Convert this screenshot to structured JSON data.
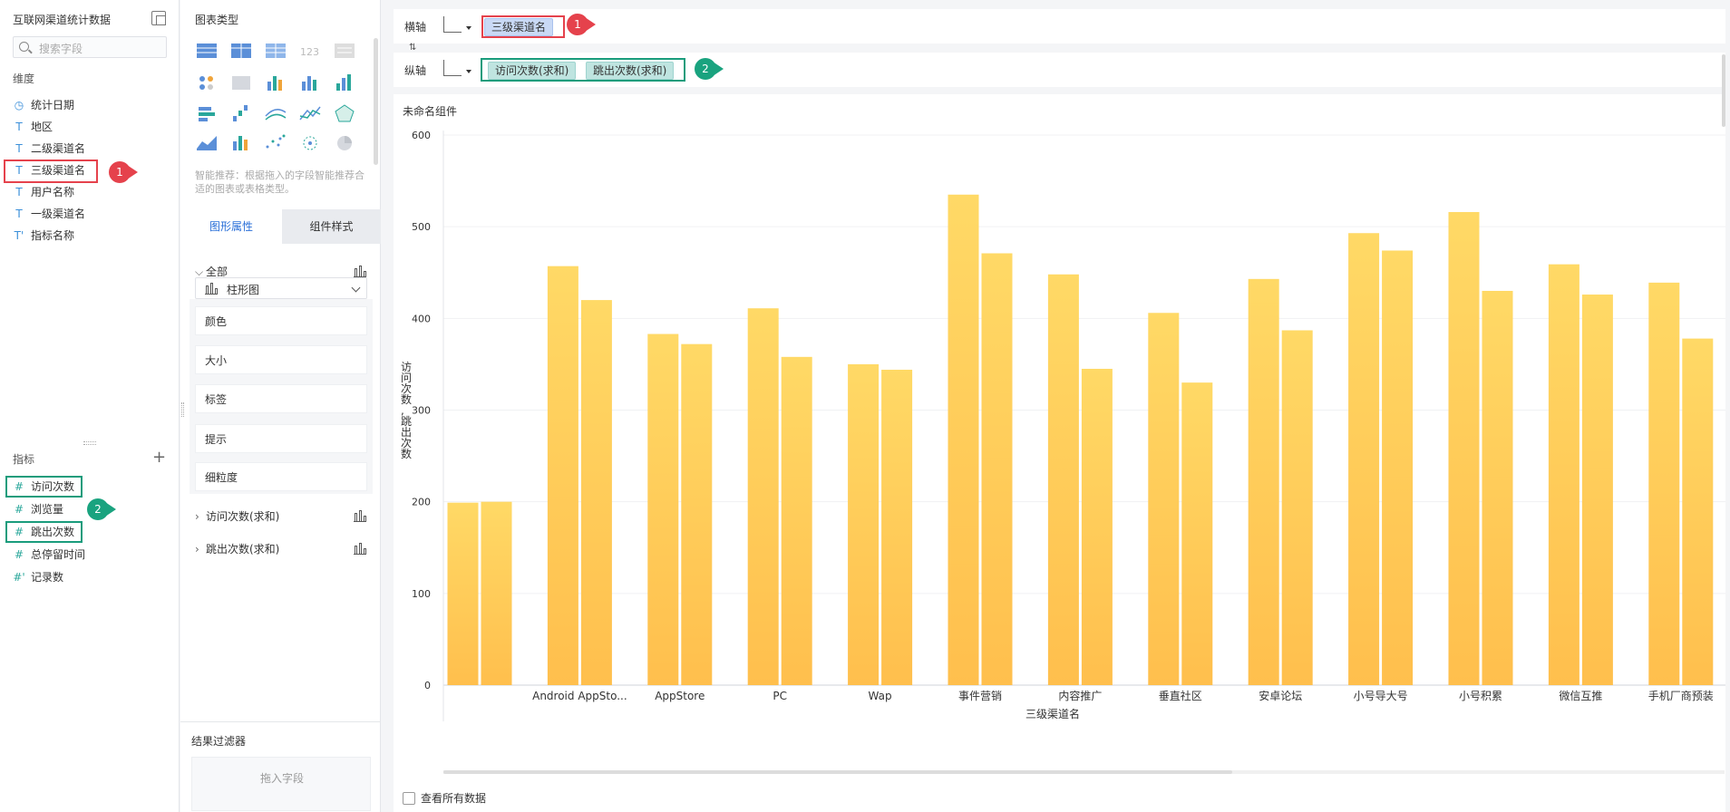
{
  "left_panel": {
    "dataset_title": "互联网渠道统计数据",
    "search_placeholder": "搜索字段",
    "dimensions_label": "维度",
    "dimensions": [
      {
        "type": "date",
        "icon": "clock-icon",
        "name": "统计日期"
      },
      {
        "type": "text",
        "icon": "T",
        "name": "地区"
      },
      {
        "type": "text",
        "icon": "T",
        "name": "二级渠道名"
      },
      {
        "type": "text",
        "icon": "T",
        "name": "三级渠道名",
        "highlight": "red"
      },
      {
        "type": "text",
        "icon": "T",
        "name": "用户名称"
      },
      {
        "type": "text",
        "icon": "T",
        "name": "一级渠道名"
      },
      {
        "type": "text-calc",
        "icon": "T'",
        "name": "指标名称"
      }
    ],
    "measures_label": "指标",
    "measures": [
      {
        "icon": "#",
        "name": "访问次数",
        "highlight": "green"
      },
      {
        "icon": "#",
        "name": "浏览量"
      },
      {
        "icon": "#",
        "name": "跳出次数",
        "highlight": "green"
      },
      {
        "icon": "#",
        "name": "总停留时间"
      },
      {
        "icon": "#'",
        "name": "记录数"
      }
    ]
  },
  "middle_panel": {
    "chart_types_label": "图表类型",
    "hint": "智能推荐：根据拖入的字段智能推荐合适的图表或表格类型。",
    "tabs": [
      "图形属性",
      "组件样式"
    ],
    "all_group": "全部",
    "chart_type_selected": "柱形图",
    "properties": [
      "颜色",
      "大小",
      "标签",
      "提示",
      "细粒度"
    ],
    "series_groups": [
      "访问次数(求和)",
      "跳出次数(求和)"
    ],
    "filter_title": "结果过滤器",
    "drop_hint": "拖入字段"
  },
  "axes": {
    "x_label": "横轴",
    "x_fields": [
      "三级渠道名"
    ],
    "y_label": "纵轴",
    "y_fields": [
      "访问次数(求和)",
      "跳出次数(求和)"
    ]
  },
  "annotations": {
    "badge1": "1",
    "badge2": "2"
  },
  "widget": {
    "title": "未命名组件",
    "show_all_data": "查看所有数据"
  },
  "colors": {
    "bar_top": "#ffd966",
    "bar_bottom": "#ffbf4d",
    "accent": "#2a6fd8",
    "highlight_red": "#e5424c",
    "highlight_green": "#1a9c7c"
  },
  "chart_data": {
    "type": "bar",
    "xlabel": "三级渠道名",
    "ylabel": "访问次数,跳出次数",
    "ylim": [
      0,
      600
    ],
    "yticks": [
      0,
      100,
      200,
      300,
      400,
      500,
      600
    ],
    "categories": [
      "",
      "Android AppSto...",
      "AppStore",
      "PC",
      "Wap",
      "事件营销",
      "内容推广",
      "垂直社区",
      "安卓论坛",
      "小号导大号",
      "小号积累",
      "微信互推",
      "手机厂商预装"
    ],
    "series": [
      {
        "name": "访问次数(求和)",
        "values": [
          199,
          457,
          383,
          411,
          350,
          535,
          448,
          406,
          443,
          493,
          516,
          459,
          439
        ]
      },
      {
        "name": "跳出次数(求和)",
        "values": [
          200,
          420,
          372,
          358,
          344,
          471,
          345,
          330,
          387,
          474,
          430,
          426,
          378
        ]
      }
    ],
    "grid": true,
    "legend": "none"
  }
}
